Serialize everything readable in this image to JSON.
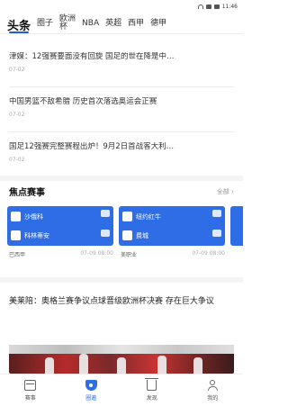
{
  "status_bar": {
    "time": "11:46"
  },
  "top_tabs": [
    {
      "label": "头条"
    },
    {
      "label": "圈子"
    },
    {
      "label": "欧洲杯"
    },
    {
      "label": "NBA"
    },
    {
      "label": "英超"
    },
    {
      "label": "西甲"
    },
    {
      "label": "德甲"
    }
  ],
  "news": [
    {
      "title": "津媒：12强赛要面没有回旋 国足的世在降是中…",
      "time": "07-02"
    },
    {
      "title": "中国男篮不敌希腊 历史首次落选奥运会正赛",
      "time": "07-02"
    },
    {
      "title": "国足12强赛完整赛程出炉！9月2日首战客大利…",
      "time": "07-02"
    }
  ],
  "hot_matches": {
    "title": "焦点赛事",
    "more_label": "全部",
    "cards": [
      {
        "home": "沙俄科",
        "away": "科林蒂安",
        "league": "巴西甲",
        "time": "07-09 08:00"
      },
      {
        "home": "纽约红牛",
        "away": "费城",
        "league": "美职业",
        "time": "07-09 08:00"
      }
    ]
  },
  "article": {
    "title": "美莱陪：奥格兰赛争议点球晋级欧洲杯决赛 存在巨大争议"
  },
  "bottom_nav": [
    {
      "label": "赛事",
      "icon": "calendar-icon"
    },
    {
      "label": "圈遨",
      "icon": "shield-icon"
    },
    {
      "label": "发现",
      "icon": "trash-icon"
    },
    {
      "label": "我的",
      "icon": "user-icon"
    }
  ],
  "colors": {
    "accent": "#2f6de6",
    "tab_underline": "#1f5fd8"
  }
}
